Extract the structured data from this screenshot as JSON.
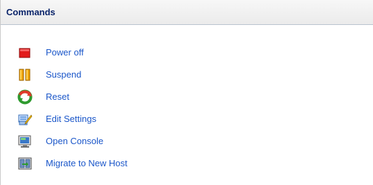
{
  "header": {
    "title": "Commands"
  },
  "commands": [
    {
      "label": "Power off",
      "icon": "power-off-icon"
    },
    {
      "label": "Suspend",
      "icon": "suspend-icon"
    },
    {
      "label": "Reset",
      "icon": "reset-icon"
    },
    {
      "label": "Edit Settings",
      "icon": "edit-settings-icon"
    },
    {
      "label": "Open Console",
      "icon": "open-console-icon"
    },
    {
      "label": "Migrate to New Host",
      "icon": "migrate-icon"
    }
  ],
  "colors": {
    "link": "#1a56c9",
    "title": "#0a246a",
    "power_off": "#e21b1b",
    "suspend": "#f0a400",
    "reset_red": "#e03a2a",
    "reset_green": "#2e9a2e"
  }
}
